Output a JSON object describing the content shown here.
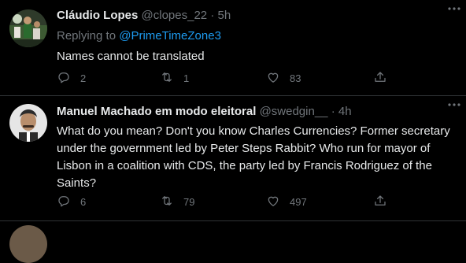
{
  "tweets": [
    {
      "display_name": "Cláudio Lopes",
      "handle": "@clopes_22",
      "separator": "·",
      "time": "5h",
      "reply_prefix": "Replying to ",
      "reply_mention": "@PrimeTimeZone3",
      "text": "Names cannot be translated",
      "replies": "2",
      "retweets": "1",
      "likes": "83"
    },
    {
      "display_name": "Manuel Machado em modo eleitoral",
      "handle": "@swedgin__",
      "separator": "·",
      "time": "4h",
      "text": "What do you mean? Don't you know Charles Currencies? Former secretary under the government led by Peter Steps Rabbit? Who run for mayor of Lisbon in a coalition with CDS, the party led by Francis Rodriguez of the Saints?",
      "replies": "6",
      "retweets": "79",
      "likes": "497"
    }
  ],
  "icons": {
    "more": "more-horizontal-icon",
    "reply": "reply-icon",
    "retweet": "retweet-icon",
    "like": "heart-icon",
    "share": "share-icon"
  },
  "colors": {
    "background": "#000000",
    "text": "#e7e9ea",
    "muted": "#71767b",
    "link": "#1d9bf0",
    "divider": "#2f3336"
  }
}
